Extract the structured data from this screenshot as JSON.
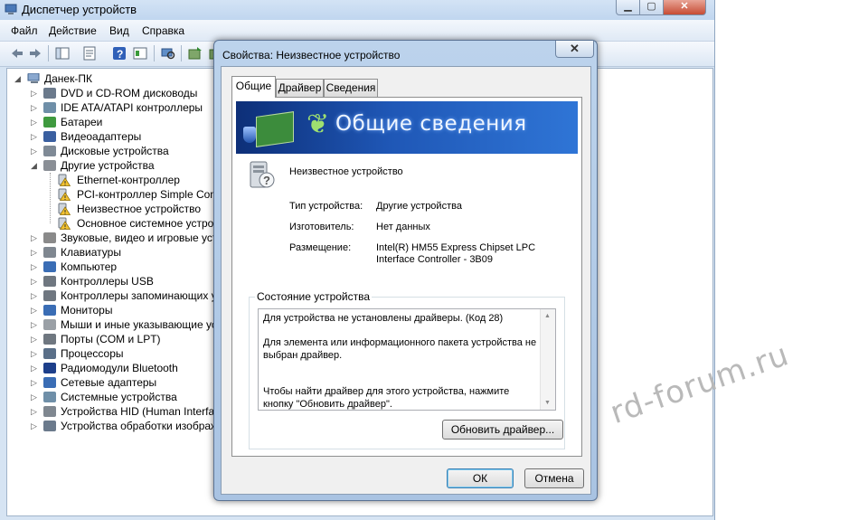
{
  "window": {
    "title": "Диспетчер устройств",
    "menu": [
      "Файл",
      "Действие",
      "Вид",
      "Справка"
    ]
  },
  "toolbar": {
    "icons": [
      "back-icon",
      "forward-icon",
      "console-tree-icon",
      "properties-icon",
      "help-icon",
      "show-hide-icon",
      "scan-hardware-icon",
      "update-driver-icon",
      "disable-icon",
      "uninstall-icon"
    ]
  },
  "tree": {
    "root": "Данек-ПК",
    "items": [
      {
        "label": "DVD и CD-ROM дисководы",
        "icon": "dvd-icon",
        "color": "#6b7a8c"
      },
      {
        "label": "IDE ATA/ATAPI контроллеры",
        "icon": "ide-controller-icon",
        "color": "#6f8fa8"
      },
      {
        "label": "Батареи",
        "icon": "battery-icon",
        "color": "#3f9a3f"
      },
      {
        "label": "Видеоадаптеры",
        "icon": "display-adapter-icon",
        "color": "#3a5fa0"
      },
      {
        "label": "Дисковые устройства",
        "icon": "disk-drive-icon",
        "color": "#7f8a96"
      },
      {
        "label": "Другие устройства",
        "icon": "other-devices-icon",
        "color": "#8a8f96",
        "expanded": true
      },
      {
        "label": "Ethernet-контроллер",
        "icon": "unknown-device-warning-icon",
        "child": true
      },
      {
        "label": "PCI-контроллер Simple Comm",
        "icon": "unknown-device-warning-icon",
        "child": true
      },
      {
        "label": "Неизвестное устройство",
        "icon": "unknown-device-warning-icon",
        "child": true
      },
      {
        "label": "Основное системное устрой",
        "icon": "unknown-device-warning-icon",
        "child": true
      },
      {
        "label": "Звуковые, видео и игровые устр",
        "icon": "sound-icon",
        "color": "#8a8a8a"
      },
      {
        "label": "Клавиатуры",
        "icon": "keyboard-icon",
        "color": "#7f8790"
      },
      {
        "label": "Компьютер",
        "icon": "computer-icon",
        "color": "#3a6db5"
      },
      {
        "label": "Контроллеры USB",
        "icon": "usb-icon",
        "color": "#6f7780"
      },
      {
        "label": "Контроллеры запоминающих ус",
        "icon": "storage-controller-icon",
        "color": "#6f7780"
      },
      {
        "label": "Мониторы",
        "icon": "monitor-icon",
        "color": "#3a6db5"
      },
      {
        "label": "Мыши и иные указывающие устр",
        "icon": "mouse-icon",
        "color": "#9aa0a6"
      },
      {
        "label": "Порты (COM и LPT)",
        "icon": "port-icon",
        "color": "#6f7780"
      },
      {
        "label": "Процессоры",
        "icon": "processor-icon",
        "color": "#5a6f88"
      },
      {
        "label": "Радиомодули Bluetooth",
        "icon": "bluetooth-icon",
        "color": "#1d3f8a"
      },
      {
        "label": "Сетевые адаптеры",
        "icon": "network-adapter-icon",
        "color": "#3a6db5"
      },
      {
        "label": "Системные устройства",
        "icon": "system-device-icon",
        "color": "#6f8fa8"
      },
      {
        "label": "Устройства HID (Human Interface",
        "icon": "hid-icon",
        "color": "#7f8790"
      },
      {
        "label": "Устройства обработки изображ",
        "icon": "imaging-device-icon",
        "color": "#6b7a8c"
      }
    ]
  },
  "dialog": {
    "title": "Свойства: Неизвестное устройство",
    "tabs": [
      "Общие",
      "Драйвер",
      "Сведения"
    ],
    "active_tab": "Общие",
    "banner_text": "Общие сведения",
    "device_name": "Неизвестное устройство",
    "properties": [
      {
        "label": "Тип устройства:",
        "value": "Другие устройства"
      },
      {
        "label": "Изготовитель:",
        "value": "Нет данных"
      },
      {
        "label": "Размещение:",
        "value": "Intel(R) HM55 Express Chipset LPC\nInterface Controller - 3B09"
      }
    ],
    "status_title": "Состояние устройства",
    "status_text": "Для устройства не установлены драйверы. (Код 28)\n\nДля элемента или информационного пакета устройства не выбран драйвер.\n\n\nЧтобы найти драйвер для этого устройства, нажмите кнопку \"Обновить драйвер\".",
    "update_driver_label": "Обновить драйвер...",
    "ok_label": "ОК",
    "cancel_label": "Отмена"
  },
  "watermark": "rd-forum.ru"
}
